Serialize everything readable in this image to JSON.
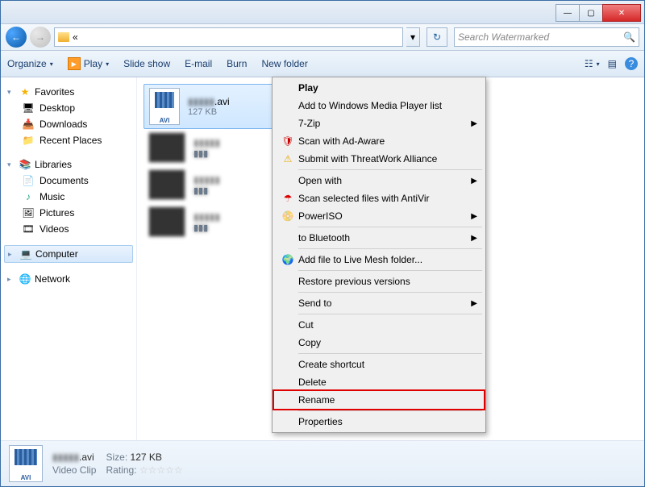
{
  "window": {
    "minimize": "—",
    "maximize": "▢",
    "close": "✕"
  },
  "address": {
    "path_marker": "«",
    "dropdown": "▾",
    "refresh_glyph": "↻",
    "search_placeholder": "Search Watermarked",
    "search_glyph": "🔍"
  },
  "toolbar": {
    "organize": "Organize",
    "organize_drop": "▾",
    "play": "Play",
    "play_drop": "▾",
    "play_glyph": "▶",
    "slideshow": "Slide show",
    "email": "E-mail",
    "burn": "Burn",
    "newfolder": "New folder",
    "help_glyph": "?"
  },
  "nav": {
    "favorites": {
      "label": "Favorites",
      "items": [
        "Desktop",
        "Downloads",
        "Recent Places"
      ]
    },
    "libraries": {
      "label": "Libraries",
      "items": [
        "Documents",
        "Music",
        "Pictures",
        "Videos"
      ]
    },
    "computer": {
      "label": "Computer"
    },
    "network": {
      "label": "Network"
    }
  },
  "files": {
    "selected": {
      "name_hidden": "▮▮▮▮▮",
      "ext": ".avi",
      "size": "127 KB",
      "icon_label": "AVI"
    },
    "others": [
      {
        "name_hidden": "▮▮▮▮▮",
        "sub_hidden": "▮▮▮"
      },
      {
        "name_hidden": "▮▮▮▮▮",
        "sub_hidden": "▮▮▮"
      },
      {
        "name_hidden": "▮▮▮▮▮",
        "sub_hidden": "▮▮▮"
      }
    ]
  },
  "context_menu": {
    "play": "Play",
    "add_wmp": "Add to Windows Media Player list",
    "sevenzip": "7-Zip",
    "adaware": "Scan with Ad-Aware",
    "threatwork": "Submit with ThreatWork Alliance",
    "openwith": "Open with",
    "antivir": "Scan selected files with AntiVir",
    "poweriso": "PowerISO",
    "bluetooth": "to Bluetooth",
    "livemesh": "Add file to Live Mesh folder...",
    "restore": "Restore previous versions",
    "sendto": "Send to",
    "cut": "Cut",
    "copy": "Copy",
    "shortcut": "Create shortcut",
    "delete": "Delete",
    "rename": "Rename",
    "properties": "Properties",
    "submenu": "▶"
  },
  "details": {
    "name_hidden": "▮▮▮▮▮",
    "ext": ".avi",
    "type": "Video Clip",
    "size_label": "Size:",
    "size": "127 KB",
    "rating_label": "Rating:",
    "star": "☆"
  },
  "icons": {
    "star": "★",
    "desktop": "🖥",
    "download": "📥",
    "recent": "📁",
    "doc": "📄",
    "music": "♪",
    "pic": "🖼",
    "vid": "🎞",
    "computer": "💻",
    "network": "🌐",
    "shield_red": "🛡",
    "shield_yel": "⚠",
    "umbrella": "☂",
    "disc": "📀",
    "globe": "🌍"
  }
}
